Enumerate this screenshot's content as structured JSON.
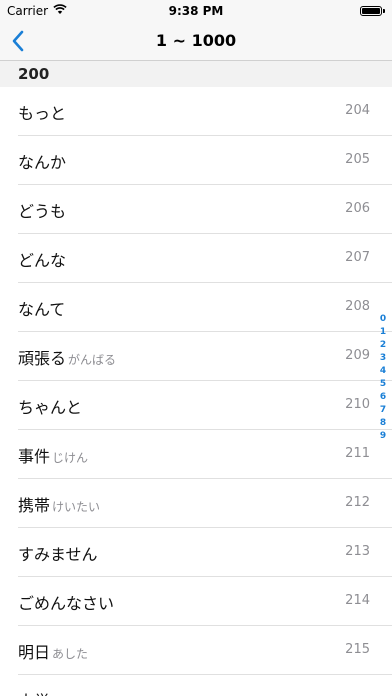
{
  "status_bar": {
    "carrier": "Carrier",
    "time": "9:38 PM"
  },
  "nav": {
    "title": "1 ~ 1000",
    "back_icon": "chevron-left-icon",
    "accent": "#1a7fd6"
  },
  "section": {
    "title": "200"
  },
  "rows": [
    {
      "word": "もっと",
      "reading": "",
      "number": "204"
    },
    {
      "word": "なんか",
      "reading": "",
      "number": "205"
    },
    {
      "word": "どうも",
      "reading": "",
      "number": "206"
    },
    {
      "word": "どんな",
      "reading": "",
      "number": "207"
    },
    {
      "word": "なんて",
      "reading": "",
      "number": "208"
    },
    {
      "word": "頑張る",
      "reading": "がんばる",
      "number": "209"
    },
    {
      "word": "ちゃんと",
      "reading": "",
      "number": "210"
    },
    {
      "word": "事件",
      "reading": "じけん",
      "number": "211"
    },
    {
      "word": "携帯",
      "reading": "けいたい",
      "number": "212"
    },
    {
      "word": "すみません",
      "reading": "",
      "number": "213"
    },
    {
      "word": "ごめんなさい",
      "reading": "",
      "number": "214"
    },
    {
      "word": "明日",
      "reading": "あした",
      "number": "215"
    },
    {
      "word": "大学",
      "reading": "",
      "number": ""
    }
  ],
  "index": [
    "0",
    "1",
    "2",
    "3",
    "4",
    "5",
    "6",
    "7",
    "8",
    "9"
  ]
}
